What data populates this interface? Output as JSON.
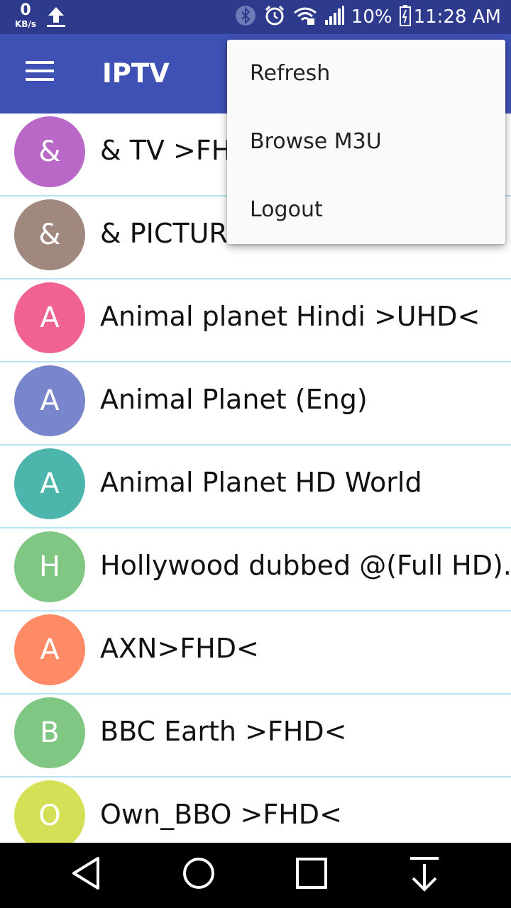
{
  "status_bar": {
    "speed_value": "0",
    "speed_unit": "KB/s",
    "battery_percent": "10%",
    "time": "11:28 AM",
    "icons": [
      "upload-icon",
      "bluetooth-icon",
      "alarm-icon",
      "wifi-icon",
      "signal-icon",
      "battery-icon"
    ]
  },
  "app_bar": {
    "title": "IPTV",
    "menu_icon": "hamburger-menu-icon"
  },
  "overflow_menu": {
    "items": [
      {
        "label": "Refresh"
      },
      {
        "label": "Browse M3U"
      },
      {
        "label": "Logout"
      }
    ]
  },
  "channels": [
    {
      "letter": "&",
      "name": "& TV >FHD<",
      "color": "#ba68c8"
    },
    {
      "letter": "&",
      "name": "& PICTURE >FHD<",
      "color": "#a1887f"
    },
    {
      "letter": "A",
      "name": "Animal planet Hindi >UHD<",
      "color": "#f06292"
    },
    {
      "letter": "A",
      "name": "Animal Planet (Eng)",
      "color": "#7986cb"
    },
    {
      "letter": "A",
      "name": "Animal Planet HD World",
      "color": "#4db6ac"
    },
    {
      "letter": "H",
      "name": "Hollywood dubbed @(Full HD).",
      "color": "#81c784"
    },
    {
      "letter": "A",
      "name": "AXN>FHD<",
      "color": "#ff8a65"
    },
    {
      "letter": "B",
      "name": "BBC Earth >FHD<",
      "color": "#81c784"
    },
    {
      "letter": "O",
      "name": "Own_BBO >FHD<",
      "color": "#d4e157"
    }
  ],
  "nav_bar": {
    "buttons": [
      "back-icon",
      "home-icon",
      "recents-icon",
      "notification-pull-icon"
    ]
  }
}
